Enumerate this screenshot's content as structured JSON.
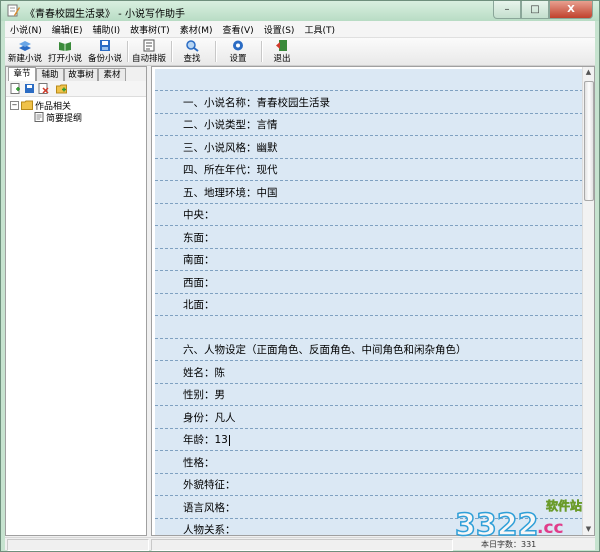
{
  "window": {
    "title": "《青春校园生活录》 - 小说写作助手",
    "controls": [
      "–",
      "□",
      "X"
    ]
  },
  "menubar": [
    "小说(N)",
    "编辑(E)",
    "辅助(I)",
    "故事树(T)",
    "素材(M)",
    "查看(V)",
    "设置(S)",
    "工具(T)"
  ],
  "toolbar": [
    {
      "label": "新建小说",
      "icon": "new-novel-icon",
      "color": "#2b6cc4"
    },
    {
      "label": "打开小说",
      "icon": "open-novel-icon",
      "color": "#3a8a3a"
    },
    {
      "label": "备份小说",
      "icon": "backup-novel-icon",
      "color": "#2b6cc4"
    },
    {
      "label": "自动排版",
      "icon": "auto-layout-icon",
      "color": "#555555"
    },
    {
      "label": "查找",
      "icon": "find-icon",
      "color": "#2b6cc4"
    },
    {
      "label": "设置",
      "icon": "settings-icon",
      "color": "#2b6cc4"
    },
    {
      "label": "退出",
      "icon": "exit-icon",
      "color": "#3a8a3a"
    }
  ],
  "left_panel": {
    "tabs": [
      "章节",
      "辅助",
      "故事树",
      "素材"
    ],
    "active_tab": "章节",
    "mini_tools": [
      "add-chapter-icon",
      "save-chapter-icon",
      "delete-chapter-icon",
      "add-folder-icon"
    ],
    "tree": [
      {
        "label": "作品相关",
        "expander": "−",
        "icon": "folder-icon"
      },
      {
        "label": "简要提纲",
        "icon": "document-icon"
      }
    ]
  },
  "editor": {
    "lines": [
      "",
      "一、小说名称：青春校园生活录",
      "二、小说类型：言情",
      "三、小说风格：幽默",
      "四、所在年代：现代",
      "五、地理环境：中国",
      "中央：",
      "东面：",
      "南面：",
      "西面：",
      "北面：",
      "",
      "六、人物设定（正面角色、反面角色、中间角色和闲杂角色）",
      "姓名：陈",
      "性别：男",
      "身份：凡人",
      "年龄：13",
      "性格：",
      "外貌特征：",
      "语言风格：",
      "人物关系："
    ],
    "caret_line": 16,
    "scroll_position": 0.05
  },
  "statusbar": {
    "text": "本日字数：331"
  },
  "watermark": {
    "logo_text": "3322",
    "site_text": "软件站",
    "domain": ".cc"
  }
}
